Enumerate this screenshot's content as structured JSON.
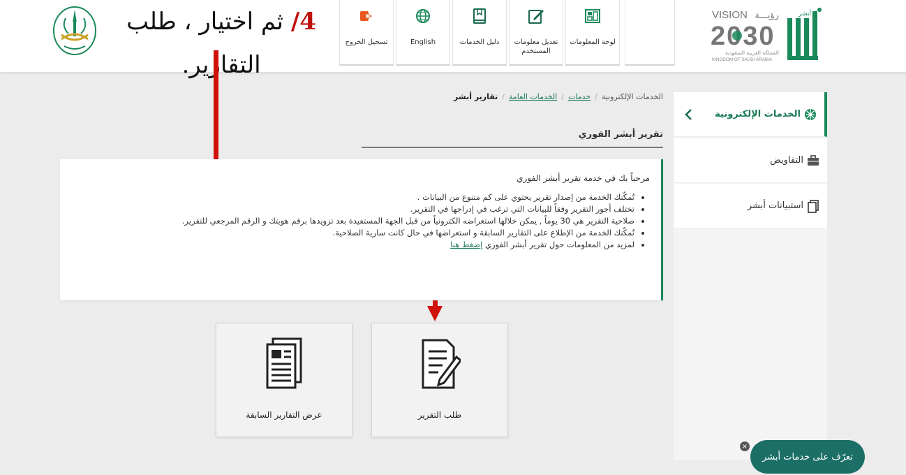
{
  "header": {
    "nav": [
      {
        "id": "logout",
        "label": "تسجيل الخروج",
        "icon": "logout-icon"
      },
      {
        "id": "english",
        "label": "English",
        "icon": "globe-icon"
      },
      {
        "id": "services-guide",
        "label": "دليل الخدمات",
        "icon": "book-icon"
      },
      {
        "id": "edit-user-info",
        "label": "تعديل معلومات المستخدم",
        "icon": "edit-icon"
      },
      {
        "id": "dashboard",
        "label": "لوحة المعلومات",
        "icon": "dashboard-icon"
      },
      {
        "id": "blank",
        "label": "",
        "icon": ""
      }
    ],
    "vision": {
      "title": "VISION",
      "title_ar": "رؤيـــة",
      "year": "2030",
      "kingdom_ar": "المملكة العربية السعودية",
      "kingdom_en": "KINGDOM OF SAUDI ARABIA"
    },
    "logo_text": "أبشر"
  },
  "annotation": {
    "number": "4/",
    "line1": "ثم اختيار ، طلب",
    "line2": "التقارير."
  },
  "breadcrumb": {
    "items": [
      {
        "label": "الخدمات الإلكترونية",
        "type": "text"
      },
      {
        "label": "خدمات",
        "type": "link"
      },
      {
        "label": "الخدمات العامة",
        "type": "link"
      },
      {
        "label": "تقارير أبشر",
        "type": "current"
      }
    ]
  },
  "page_title": "تقرير أبشر الفوري",
  "info": {
    "welcome": "مرحباً بك في خدمة تقرير أبشر الفوري",
    "bullets": [
      "تُمكّنك الخدمة من إصدار تقرير يحتوي على كم متنوع من البيانات .",
      "تختلف أجور التقرير وفقاً للبيانات التي ترغب في إدراجها في التقرير.",
      "صلاحية التقرير هي 30 يوماً , يمكن خلالها استعراضه الكترونياً من قبل الجهة المستفيدة بعد تزويدها برقم هويتك و الرقم المرجعي للتقرير.",
      "تُمكّنك الخدمة من الإطلاع على التقارير السابقة و استعراضها في حال كانت سارية الصلاحية."
    ],
    "more_text": "لمزيد من المعلومات حول تقرير أبشر الفوري",
    "more_link": "إضغط هنا"
  },
  "tiles": {
    "request": {
      "label": "طلب التقرير",
      "icon": "request-report-icon"
    },
    "previous": {
      "label": "عرض التقارير السابقة",
      "icon": "previous-reports-icon"
    }
  },
  "sidebar": {
    "items": [
      {
        "label": "الخدمات الإلكترونية",
        "icon": "eservices-icon",
        "active": true
      },
      {
        "label": "التفاويض",
        "icon": "briefcase-icon",
        "active": false
      },
      {
        "label": "استبيانات أبشر",
        "icon": "survey-icon",
        "active": false
      }
    ]
  },
  "help": {
    "label": "تعرّف على خدمات أبشر",
    "close": "×"
  },
  "colors": {
    "brand_green": "#1b8a5a",
    "annotation_red": "#d0110a",
    "help_teal": "#1c6f67"
  }
}
